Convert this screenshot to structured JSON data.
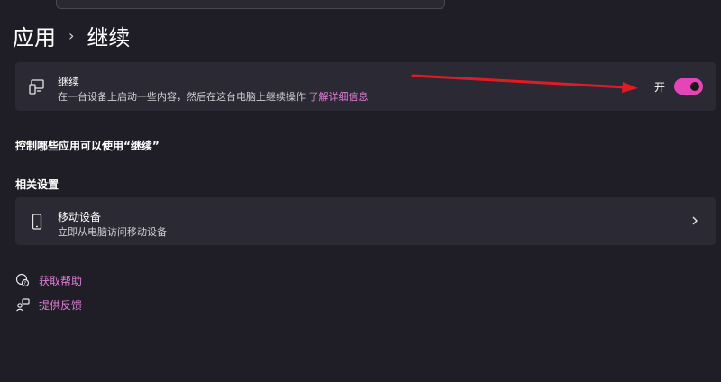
{
  "breadcrumb": {
    "parent": "应用",
    "current": "继续"
  },
  "continue_card": {
    "title": "继续",
    "description": "在一台设备上启动一些内容，然后在这台电脑上继续操作",
    "link": "了解详细信息",
    "toggle_label": "开",
    "toggle_on": true
  },
  "apps_heading": "控制哪些应用可以使用“继续”",
  "related": {
    "heading": "相关设置",
    "mobile": {
      "title": "移动设备",
      "description": "立即从电脑访问移动设备"
    }
  },
  "footer": {
    "help": "获取帮助",
    "feedback": "提供反馈"
  },
  "colors": {
    "accent": "#e545b8",
    "link": "#e27ed9",
    "arrow": "#e01b24",
    "card": "#2b2933",
    "background": "#1f1d26"
  },
  "icons": {
    "continue": "pc-phone-icon",
    "mobile": "phone-icon",
    "chevron": "chevron-right-icon",
    "help": "help-chat-icon",
    "feedback": "feedback-icon"
  }
}
